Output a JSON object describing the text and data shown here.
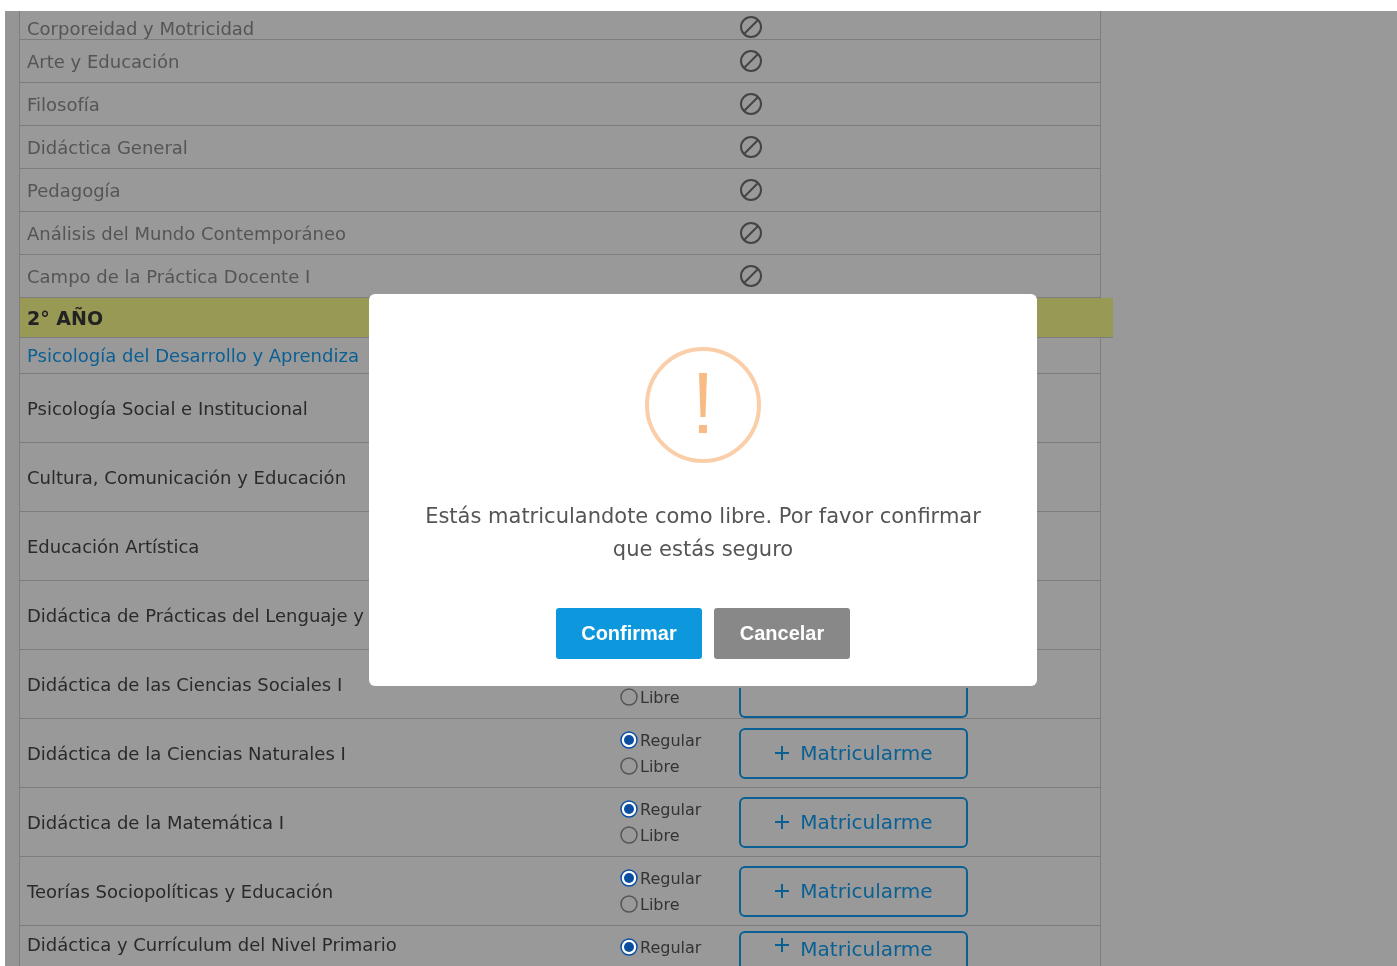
{
  "first_year_rows": [
    {
      "name": "Corporeidad y Motricidad",
      "blocked": true
    },
    {
      "name": "Arte y Educación",
      "blocked": true
    },
    {
      "name": "Filosofía",
      "blocked": true
    },
    {
      "name": "Didáctica General",
      "blocked": true
    },
    {
      "name": "Pedagogía",
      "blocked": true
    },
    {
      "name": "Análisis del Mundo Contemporáneo",
      "blocked": true
    },
    {
      "name": "Campo de la Práctica Docente I",
      "blocked": true
    }
  ],
  "year_header": "2° AÑO",
  "second_year_rows": [
    {
      "kind": "link",
      "name": "Psicología del Desarrollo y Aprendiza"
    },
    {
      "kind": "plain",
      "name": "Psicología Social e Institucional"
    },
    {
      "kind": "plain",
      "name": "Cultura, Comunicación y Educación"
    },
    {
      "kind": "plain",
      "name": "Educación Artística"
    },
    {
      "kind": "plain",
      "name": "Didáctica de Prácticas del Lenguaje y"
    },
    {
      "kind": "enroll",
      "name": "Didáctica de las Ciencias Sociales I",
      "options": [
        {
          "label": "Libre",
          "selected": false
        }
      ],
      "button": {}
    },
    {
      "kind": "enroll",
      "name": "Didáctica de la Ciencias Naturales I",
      "options": [
        {
          "label": "Regular",
          "selected": true
        },
        {
          "label": "Libre",
          "selected": false
        }
      ],
      "button": {
        "label": "Matricularme"
      }
    },
    {
      "kind": "enroll",
      "name": "Didáctica de la Matemática I",
      "options": [
        {
          "label": "Regular",
          "selected": true
        },
        {
          "label": "Libre",
          "selected": false
        }
      ],
      "button": {
        "label": "Matricularme"
      }
    },
    {
      "kind": "enroll",
      "name": "Teorías Sociopolíticas y Educación",
      "options": [
        {
          "label": "Regular",
          "selected": true
        },
        {
          "label": "Libre",
          "selected": false
        }
      ],
      "button": {
        "label": "Matricularme"
      }
    },
    {
      "kind": "enroll",
      "name": "Didáctica y Currículum del Nivel Primario",
      "options": [
        {
          "label": "Regular",
          "selected": true
        }
      ],
      "button": {
        "label": "Matricularme"
      }
    }
  ],
  "dialog": {
    "message": "Estás matriculandote como libre. Por favor confirmar que estás seguro",
    "confirm": "Confirmar",
    "cancel": "Cancelar"
  }
}
